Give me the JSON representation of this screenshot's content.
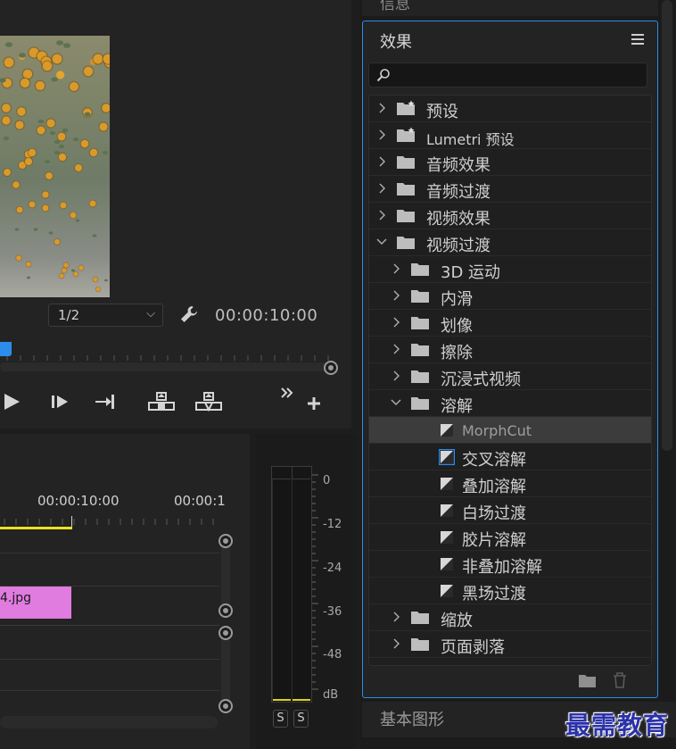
{
  "monitor": {
    "resolution": "1/2",
    "timecode": "00:00:10:00"
  },
  "timeline": {
    "tc1": "00:00:10:00",
    "tc2": "00:00:1",
    "clip_name": "4.jpg"
  },
  "meters": {
    "db_labels": [
      "0",
      "-12",
      "-24",
      "-36",
      "-48",
      "dB"
    ],
    "solo_left": "S",
    "solo_right": "S",
    "floor_color": "#d9d31c"
  },
  "info_panel": {
    "title": "信息"
  },
  "effects": {
    "title": "效果",
    "search_placeholder": "",
    "tree": [
      {
        "label": "预设",
        "kind": "folder-star",
        "level": 0,
        "expanded": false
      },
      {
        "label": "Lumetri 预设",
        "kind": "folder-star",
        "level": 0,
        "expanded": false
      },
      {
        "label": "音频效果",
        "kind": "folder",
        "level": 0,
        "expanded": false
      },
      {
        "label": "音频过渡",
        "kind": "folder",
        "level": 0,
        "expanded": false
      },
      {
        "label": "视频效果",
        "kind": "folder",
        "level": 0,
        "expanded": false
      },
      {
        "label": "视频过渡",
        "kind": "folder",
        "level": 0,
        "expanded": true
      },
      {
        "label": "3D 运动",
        "kind": "folder",
        "level": 1,
        "expanded": false
      },
      {
        "label": "内滑",
        "kind": "folder",
        "level": 1,
        "expanded": false
      },
      {
        "label": "划像",
        "kind": "folder",
        "level": 1,
        "expanded": false
      },
      {
        "label": "擦除",
        "kind": "folder",
        "level": 1,
        "expanded": false
      },
      {
        "label": "沉浸式视频",
        "kind": "folder",
        "level": 1,
        "expanded": false
      },
      {
        "label": "溶解",
        "kind": "folder",
        "level": 1,
        "expanded": true
      },
      {
        "label": "MorphCut",
        "kind": "transition",
        "level": 2,
        "selected": true
      },
      {
        "label": "交叉溶解",
        "kind": "transition",
        "level": 2,
        "default": true
      },
      {
        "label": "叠加溶解",
        "kind": "transition",
        "level": 2
      },
      {
        "label": "白场过渡",
        "kind": "transition",
        "level": 2
      },
      {
        "label": "胶片溶解",
        "kind": "transition",
        "level": 2
      },
      {
        "label": "非叠加溶解",
        "kind": "transition",
        "level": 2
      },
      {
        "label": "黑场过渡",
        "kind": "transition",
        "level": 2
      },
      {
        "label": "缩放",
        "kind": "folder",
        "level": 1,
        "expanded": false
      },
      {
        "label": "页面剥落",
        "kind": "folder",
        "level": 1,
        "expanded": false
      }
    ]
  },
  "basic_graphics": {
    "title": "基本图形"
  },
  "watermark": "最需教育",
  "colors": {
    "accent": "#2d8ceb",
    "clip": "#e07be0",
    "timeline_marker": "#e8e320"
  }
}
